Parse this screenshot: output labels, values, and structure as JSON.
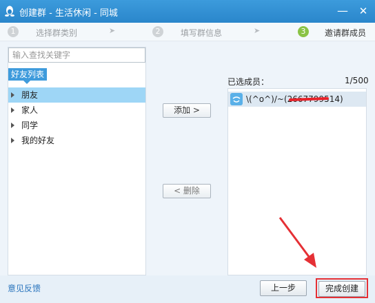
{
  "window": {
    "title": "创建群 - 生活休闲 - 同城",
    "minimize_glyph": "—",
    "close_glyph": "✕"
  },
  "steps": [
    {
      "num": "1",
      "label": "选择群类别"
    },
    {
      "num": "2",
      "label": "填写群信息"
    },
    {
      "num": "3",
      "label": "邀请群成员"
    }
  ],
  "step_arrow": "➤",
  "left": {
    "search_placeholder": "输入查找关键字",
    "tab_label": "好友列表",
    "groups": [
      "朋友",
      "家人",
      "同学",
      "我的好友"
    ]
  },
  "middle": {
    "add_label": "添加 >",
    "delete_label": "< 删除"
  },
  "right": {
    "header": "已选成员：",
    "count": "1/500",
    "members": [
      {
        "name": "\\(^o^)/~(2667799514)"
      }
    ]
  },
  "footer": {
    "feedback_label": "意见反馈",
    "prev_label": "上一步",
    "finish_label": "完成创建"
  },
  "colors": {
    "titlebar": "#2a86cb",
    "selected_row": "#9ed6f6",
    "active_step": "#8ac346",
    "highlight": "#e53035"
  }
}
